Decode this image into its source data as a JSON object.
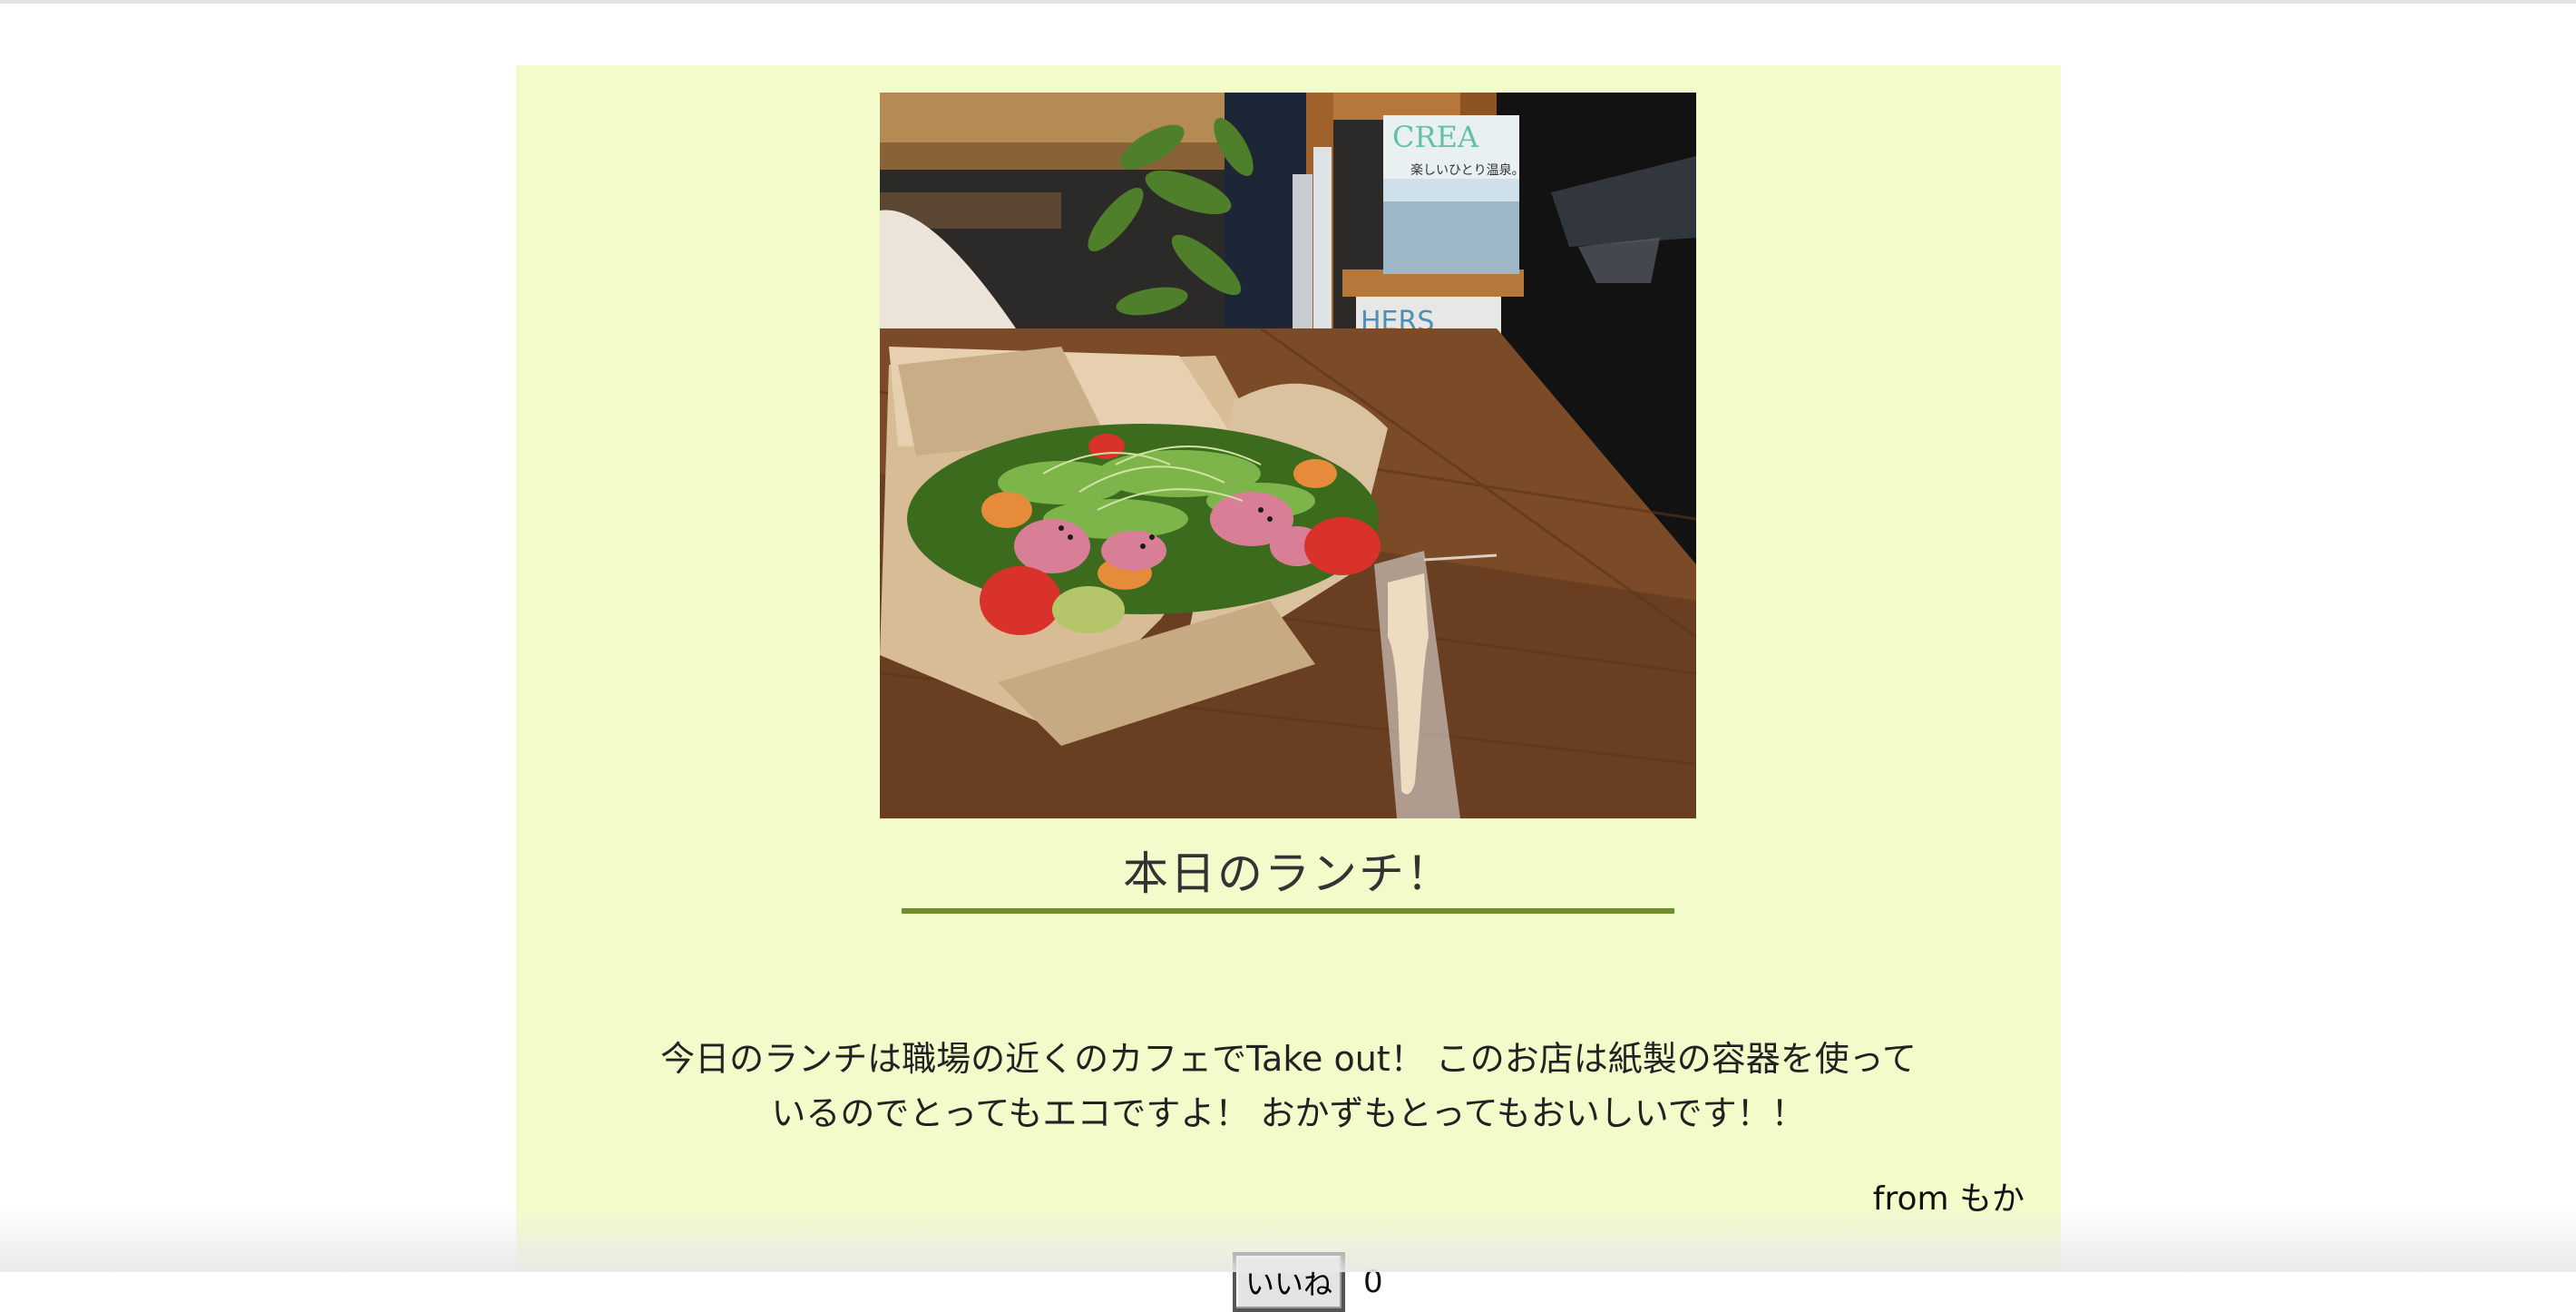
{
  "post": {
    "title": "本日のランチ！",
    "body": "今日のランチは職場の近くのカフェでTake out！ このお店は紙製の容器を使っているのでとってもエコですよ！ おかずもとってもおいしいです！！",
    "author": "from もか",
    "like_label": "いいね",
    "like_count": "0",
    "photo_magazine_text_1": "CREA",
    "photo_magazine_text_2": "楽しいひとり温泉。",
    "photo_magazine_text_3": "HERS"
  },
  "colors": {
    "card_background": "#f4fbcb",
    "title_underline": "#6f8f2c"
  }
}
